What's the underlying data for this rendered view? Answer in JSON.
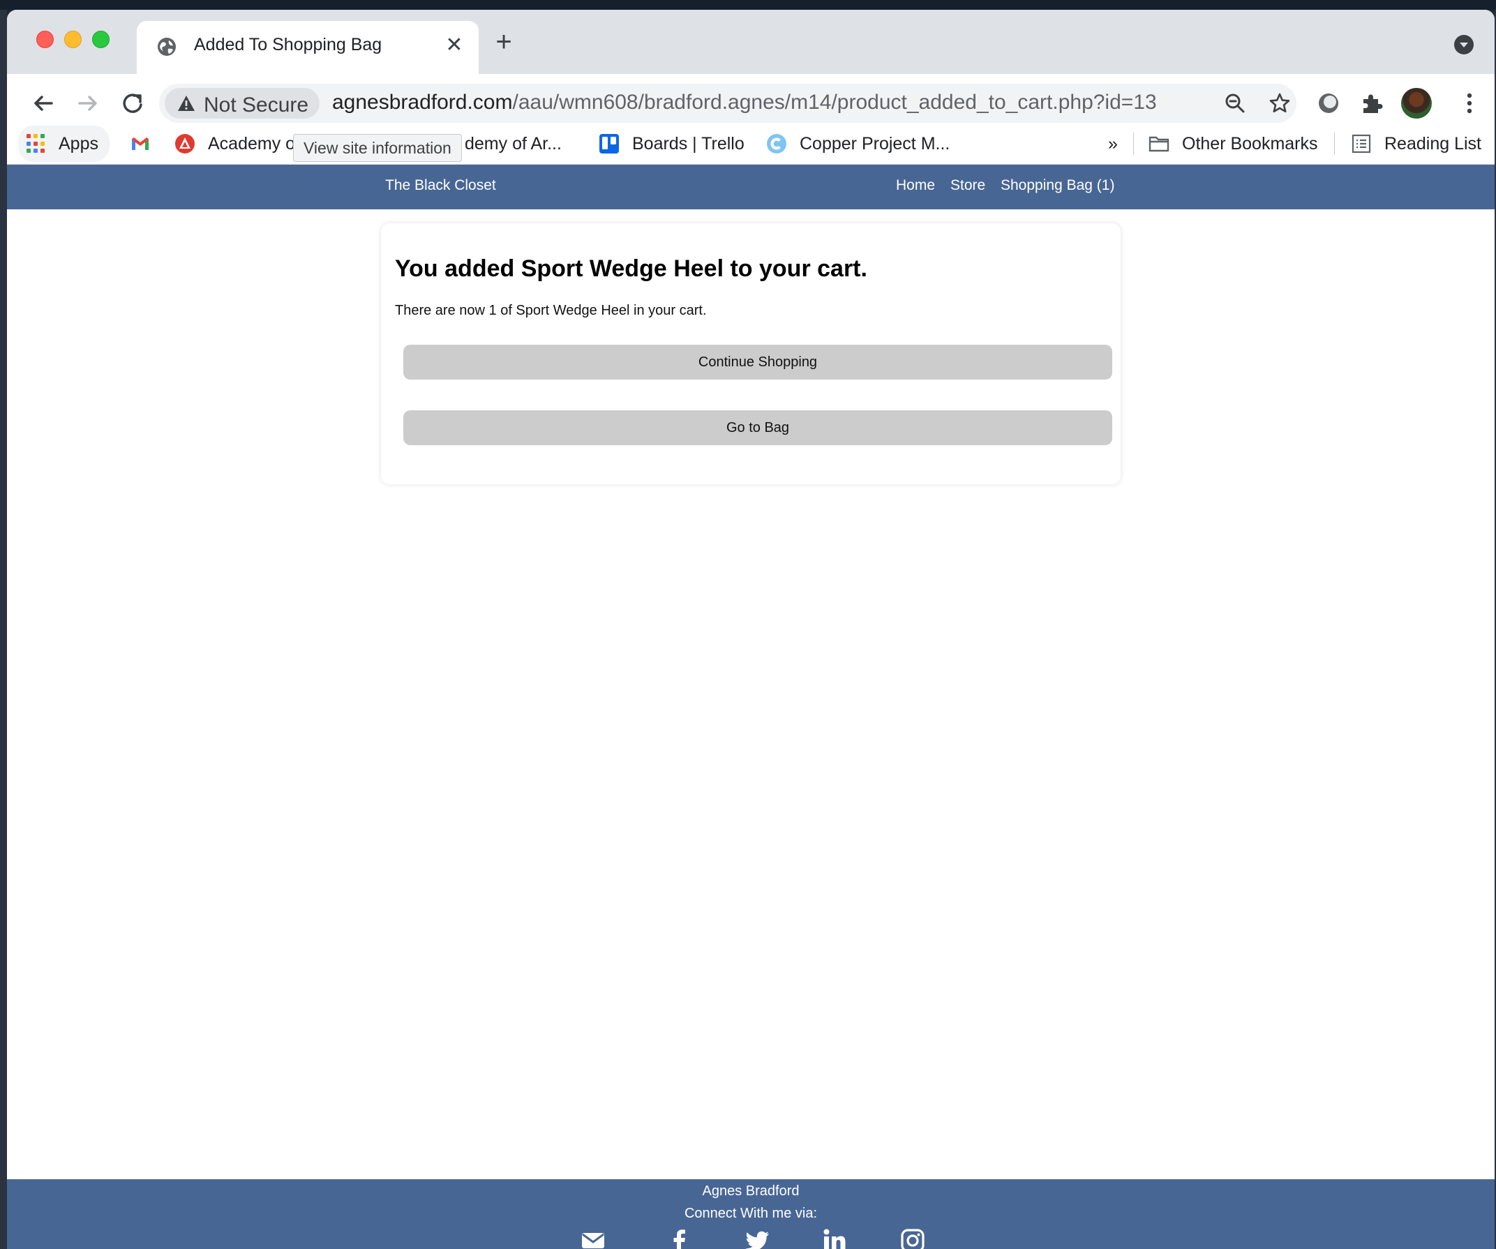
{
  "browser": {
    "tab_title": "Added To Shopping Bag",
    "security_label": "Not Secure",
    "url_host": "agnesbradford.com",
    "url_path": "/aau/wmn608/bradford.agnes/m14/product_added_to_cart.php?id=13",
    "tooltip": "View site information",
    "bookmarks": {
      "apps": "Apps",
      "academy_1": "Academy of",
      "academy_2": "demy of Ar...",
      "trello": "Boards | Trello",
      "copper": "Copper Project M...",
      "overflow": "»",
      "other": "Other Bookmarks",
      "reading": "Reading List"
    }
  },
  "site": {
    "brand": "The Black Closet",
    "nav": {
      "home": "Home",
      "store": "Store",
      "bag": "Shopping Bag (1)"
    },
    "confirmation": {
      "title": "You added Sport Wedge Heel to your cart.",
      "message": "There are now 1 of Sport Wedge Heel in your cart.",
      "continue_label": "Continue Shopping",
      "bag_label": "Go to Bag"
    },
    "footer": {
      "name": "Agnes Bradford",
      "connect": "Connect With me via:",
      "social_icons": [
        "envelope-icon",
        "facebook-icon",
        "twitter-icon",
        "linkedin-icon",
        "instagram-icon"
      ]
    }
  },
  "colors": {
    "nav_bg": "#486694",
    "button_bg": "#cccccc",
    "tabstrip_bg": "#dee1e6"
  }
}
